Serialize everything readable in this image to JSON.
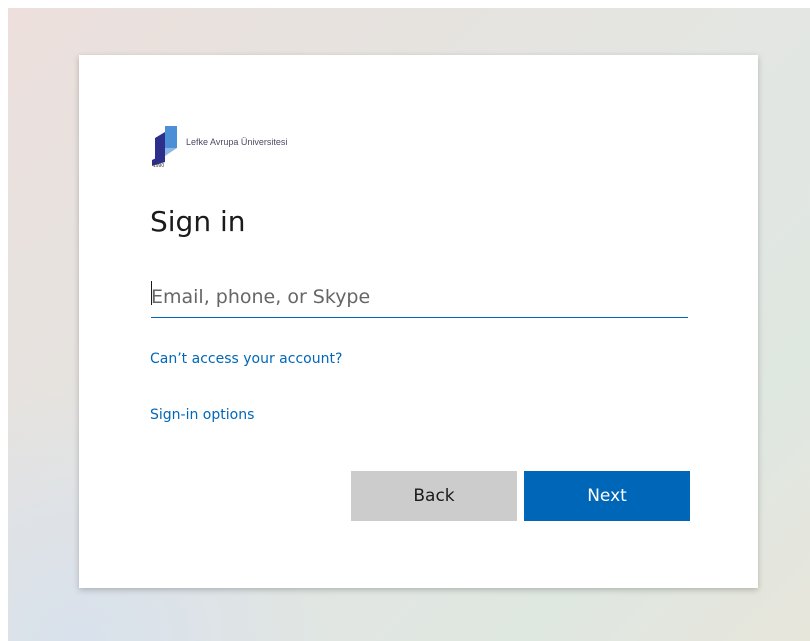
{
  "app": {
    "page_title": "Sign in"
  },
  "logo": {
    "name": "Lefke Avrupa Üniversitesi",
    "year": "1990"
  },
  "form": {
    "email_placeholder": "Email, phone, or Skype",
    "email_value": ""
  },
  "links": {
    "cant_access": "Can’t access your account?",
    "sign_in_options": "Sign-in options"
  },
  "buttons": {
    "back": "Back",
    "next": "Next"
  },
  "colors": {
    "accent": "#0067b8",
    "secondary_button": "#cccccc",
    "text": "#1b1b1b"
  }
}
